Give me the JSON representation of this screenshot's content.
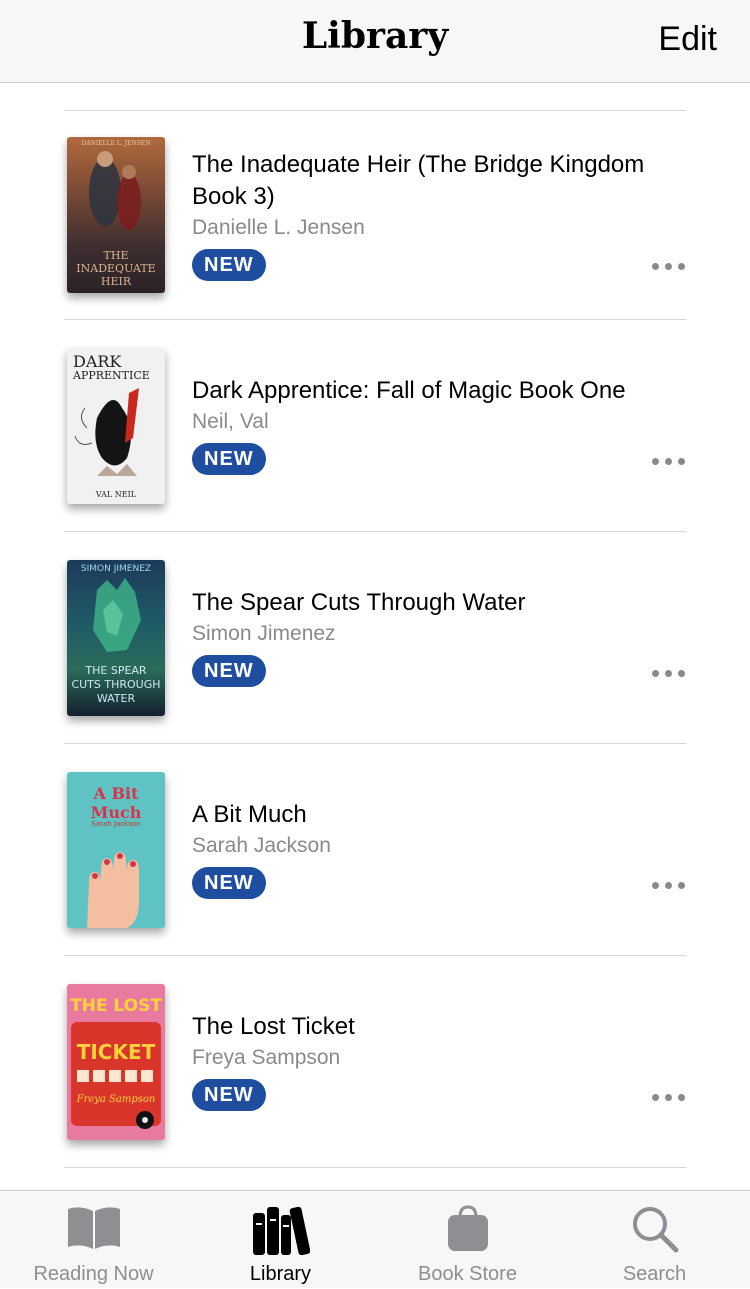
{
  "header": {
    "title": "Library",
    "edit_label": "Edit"
  },
  "books": [
    {
      "title": "The Inadequate Heir (The Bridge Kingdom Book 3)",
      "author": "Danielle L. Jensen",
      "badge": "NEW",
      "cover_colors": [
        "#8a5a3c",
        "#3a2a2a"
      ]
    },
    {
      "title": "Dark Apprentice: Fall of Magic Book One",
      "author": "Neil, Val",
      "badge": "NEW",
      "cover_colors": [
        "#f2f2f2",
        "#c8281e"
      ]
    },
    {
      "title": "The Spear Cuts Through Water",
      "author": "Simon Jimenez",
      "badge": "NEW",
      "cover_colors": [
        "#1c3b5a",
        "#3fa07a"
      ]
    },
    {
      "title": "A Bit Much",
      "author": "Sarah Jackson",
      "badge": "NEW",
      "cover_colors": [
        "#5fc3c4",
        "#f0b48c"
      ]
    },
    {
      "title": "The Lost Ticket",
      "author": "Freya Sampson",
      "badge": "NEW",
      "cover_colors": [
        "#e87a9f",
        "#d9352a"
      ]
    }
  ],
  "covers": {
    "book1": {
      "top": "DANIELLE L. JENSEN",
      "title": "THE INADEQUATE HEIR"
    },
    "book2": {
      "title1": "DARK",
      "title2": "APPRENTICE",
      "author": "VAL NEIL"
    },
    "book3": {
      "author": "SIMON JIMENEZ",
      "title": "THE SPEAR CUTS THROUGH WATER"
    },
    "book4": {
      "title": "A Bit Much",
      "author": "Sarah Jackson"
    },
    "book5": {
      "title1": "THE LOST",
      "title2": "TICKET",
      "author": "Freya Sampson"
    }
  },
  "tabs": [
    {
      "label": "Reading Now",
      "icon": "book-open-icon",
      "active": false
    },
    {
      "label": "Library",
      "icon": "books-icon",
      "active": true
    },
    {
      "label": "Book Store",
      "icon": "bag-icon",
      "active": false
    },
    {
      "label": "Search",
      "icon": "magnifier-icon",
      "active": false
    }
  ],
  "colors": {
    "badge": "#1f4ea1",
    "secondary_text": "#8a8a8e",
    "inactive_tab": "#8e8e93"
  }
}
